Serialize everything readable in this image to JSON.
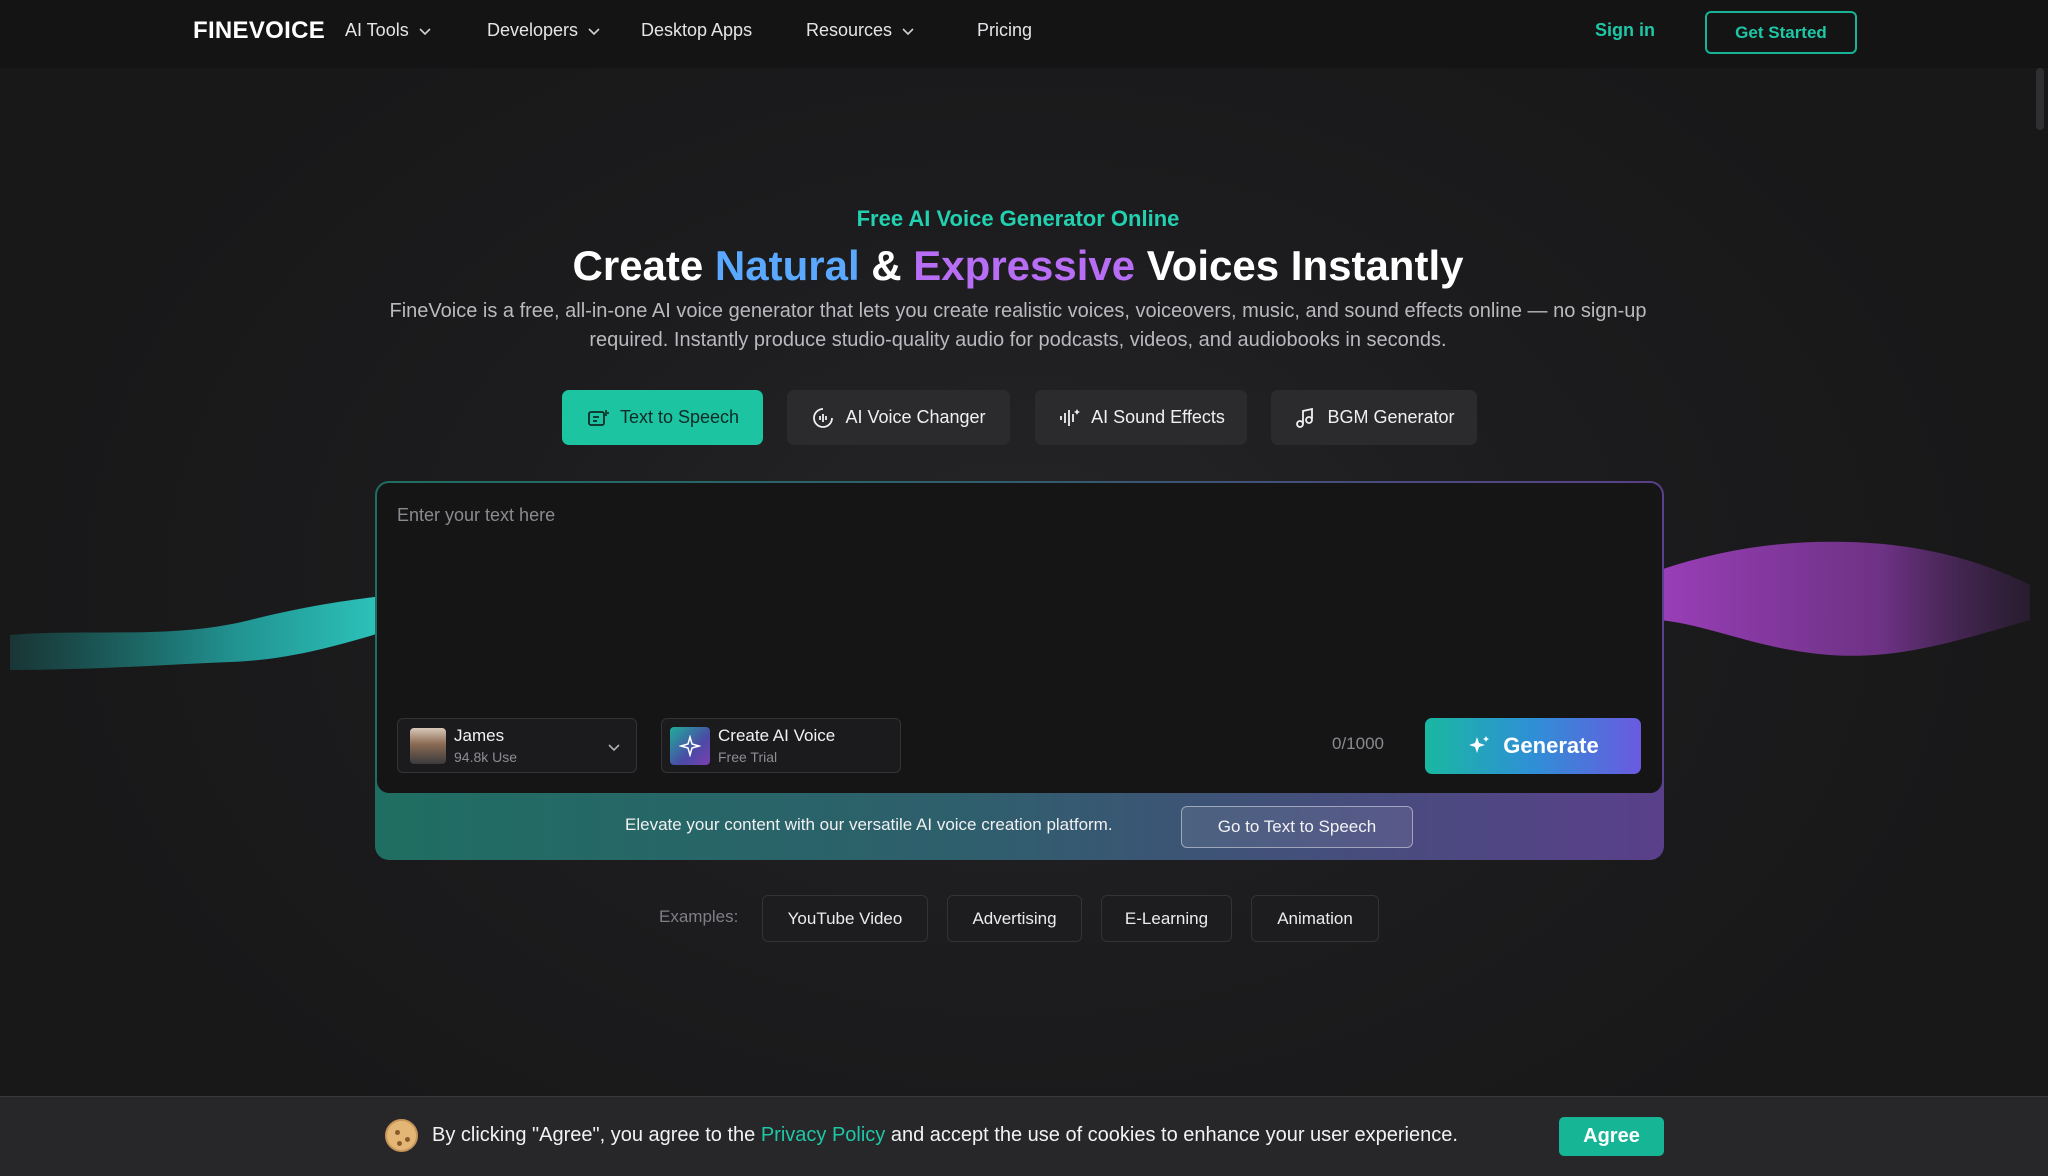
{
  "nav": {
    "logo": "FINEVOICE",
    "items": [
      {
        "label": "AI Tools",
        "has_dropdown": true
      },
      {
        "label": "Developers",
        "has_dropdown": true
      },
      {
        "label": "Desktop Apps",
        "has_dropdown": false
      },
      {
        "label": "Resources",
        "has_dropdown": true
      },
      {
        "label": "Pricing",
        "has_dropdown": false
      }
    ],
    "sign_in": "Sign in",
    "get_started": "Get Started"
  },
  "hero": {
    "eyebrow": "Free AI Voice Generator Online",
    "headline_1": "Create ",
    "headline_natural": "Natural",
    "headline_2": " & ",
    "headline_expressive": "Expressive",
    "headline_3": " Voices Instantly",
    "subtext": "FineVoice is a free, all-in-one AI voice generator that lets you create realistic voices, voiceovers, music, and sound effects online — no sign-up required. Instantly produce studio-quality audio for podcasts, videos, and audiobooks in seconds."
  },
  "tabs": [
    {
      "label": "Text to Speech",
      "icon": "text-to-speech-icon",
      "active": true
    },
    {
      "label": "AI Voice Changer",
      "icon": "voice-changer-icon",
      "active": false
    },
    {
      "label": "AI Sound Effects",
      "icon": "sound-wave-icon",
      "active": false
    },
    {
      "label": "BGM Generator",
      "icon": "music-note-icon",
      "active": false
    }
  ],
  "editor": {
    "placeholder": "Enter your text here",
    "voice": {
      "name": "James",
      "uses": "94.8k Use"
    },
    "create_voice": {
      "title": "Create AI Voice",
      "subtitle": "Free Trial"
    },
    "char_count": "0/1000",
    "generate_label": "Generate",
    "promo_text": "Elevate your content with our versatile AI voice creation platform.",
    "promo_button": "Go to Text to Speech"
  },
  "examples": {
    "label": "Examples:",
    "chips": [
      "YouTube Video",
      "Advertising",
      "E-Learning",
      "Animation"
    ]
  },
  "cookie": {
    "text_before": "By clicking \"Agree\", you agree to the ",
    "link": "Privacy Policy",
    "text_after": " and accept the use of cookies to enhance your user experience.",
    "agree": "Agree"
  },
  "colors": {
    "accent_teal": "#1cc4a2",
    "natural_blue": "#5aa8ff",
    "expressive_purple": "#b86df5",
    "background": "#1b1b1c"
  }
}
